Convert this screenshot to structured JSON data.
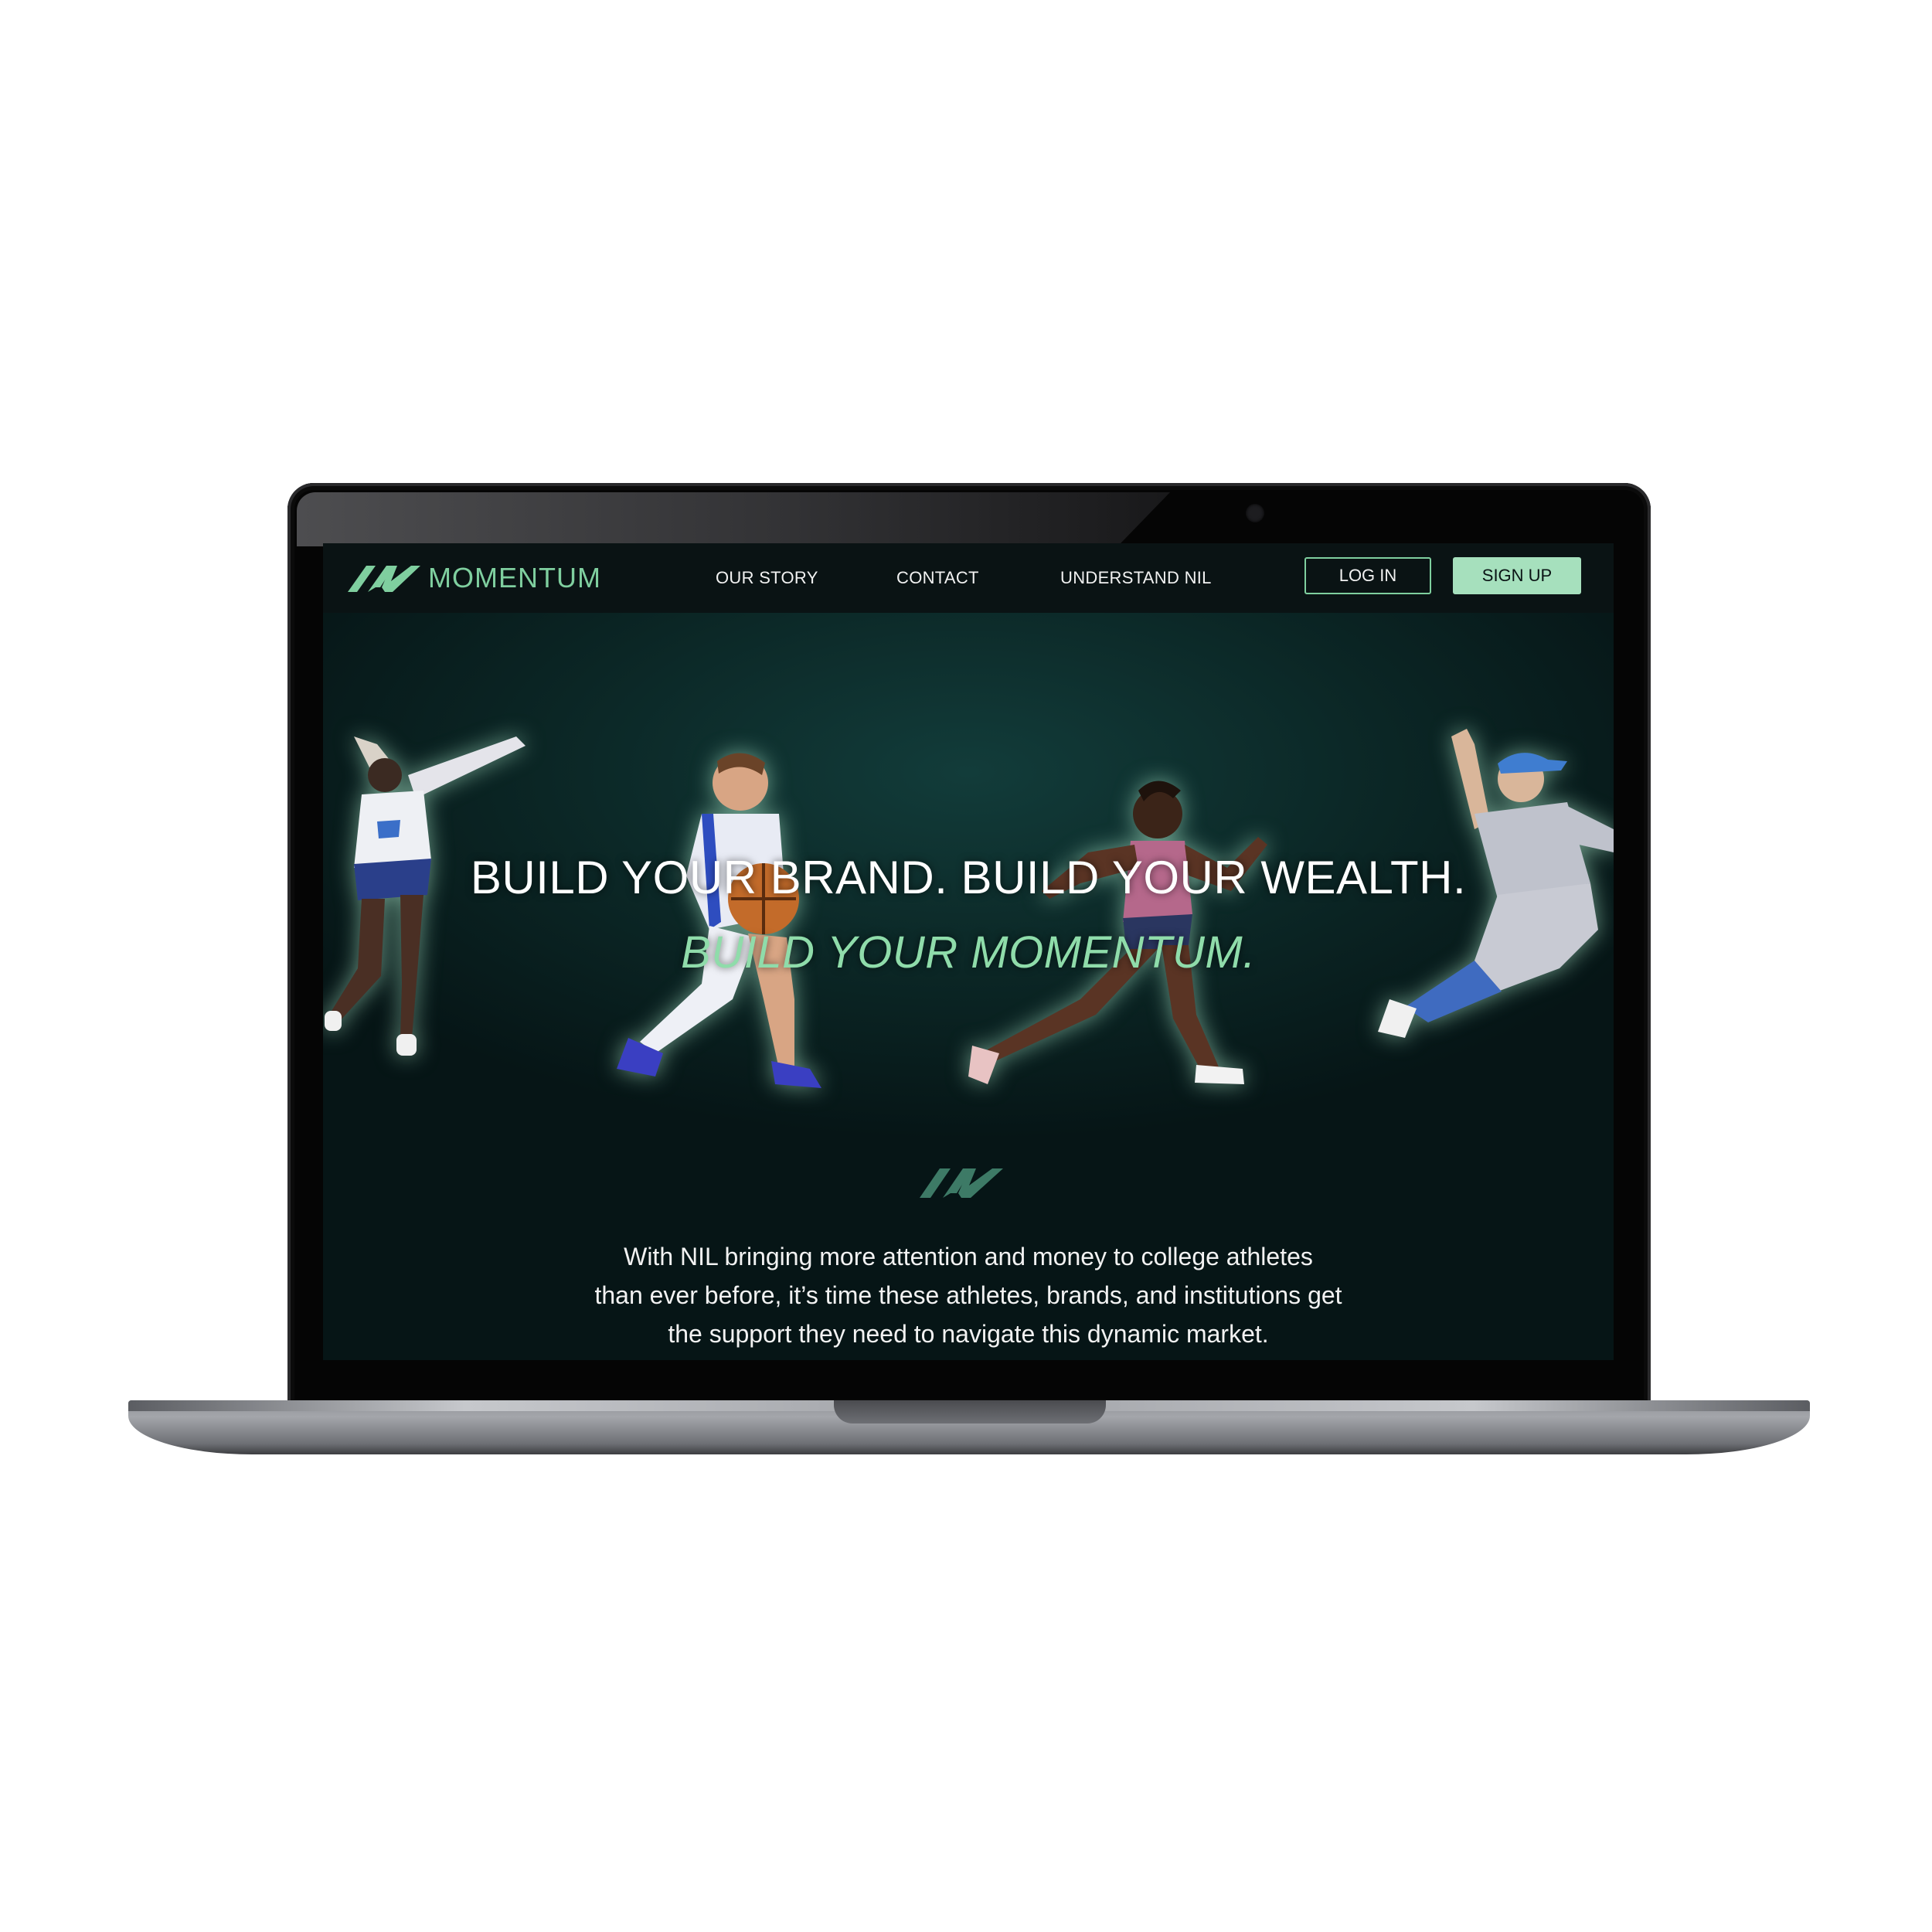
{
  "brand": {
    "name": "MOMENTUM",
    "logo_icon": "momentum-m-logo",
    "accent_color": "#7fcf9f",
    "button_fill_color": "#a6e0bd",
    "background_color": "#0b2625"
  },
  "nav": {
    "links": [
      "OUR STORY",
      "CONTACT",
      "UNDERSTAND NIL"
    ],
    "login_label": "LOG IN",
    "signup_label": "SIGN UP"
  },
  "hero": {
    "heading": "BUILD YOUR BRAND. BUILD YOUR WEALTH.",
    "subheading": "BUILD YOUR MOMENTUM.",
    "athletes": [
      "volleyball-player",
      "basketball-player",
      "sprinter",
      "baseball-pitcher"
    ]
  },
  "intro": {
    "lines": [
      "With NIL bringing more attention and money to college athletes",
      "than ever before, it’s time these athletes, brands, and institutions get",
      "the support they need to  navigate this dynamic market."
    ]
  }
}
